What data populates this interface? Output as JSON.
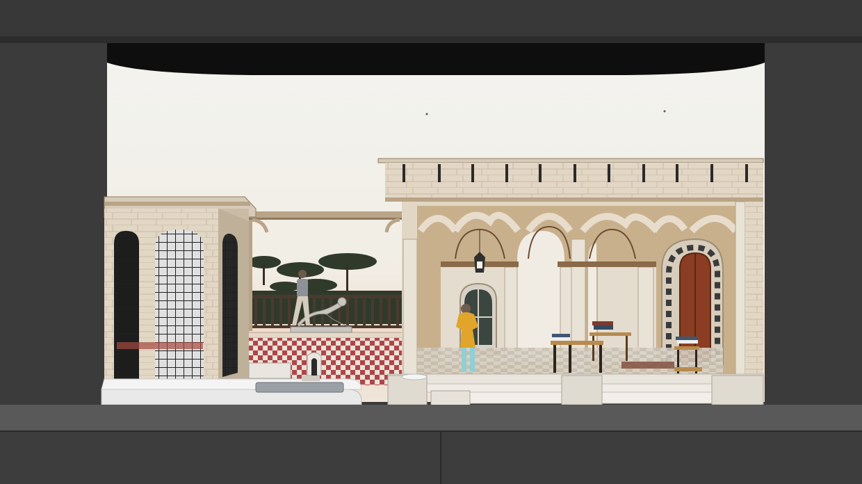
{
  "scene": {
    "colors": {
      "stage_frame": "#3a3a3a",
      "proscenium": "#2a2a2a",
      "masking_border": "#111111",
      "sky_top": "#e6e6e2",
      "sky_bottom": "#f4efe6",
      "horizon_glow": "#f2d9c4",
      "stone_light": "#e4d9c9",
      "stone_mid": "#d3c3ac",
      "stone_dark": "#b9a487",
      "stone_shadow": "#a48c6c",
      "railing": "#4a3a2e",
      "pine_foliage": "#2f3a2b",
      "wall_tile_red": "#b0454a",
      "wall_tile_cream": "#eae3d6",
      "door_wood": "#8a3d22",
      "figure_yellow": "#e0a52a",
      "figure_teal": "#8fd0d6",
      "statue": "#c9c6c0",
      "pool_water": "#9aa1a6",
      "floor": "#595959"
    },
    "icons": [
      "hanging-lantern-icon",
      "doorway-icon",
      "book-stack-icon",
      "bench-icon",
      "statue-icon"
    ]
  }
}
